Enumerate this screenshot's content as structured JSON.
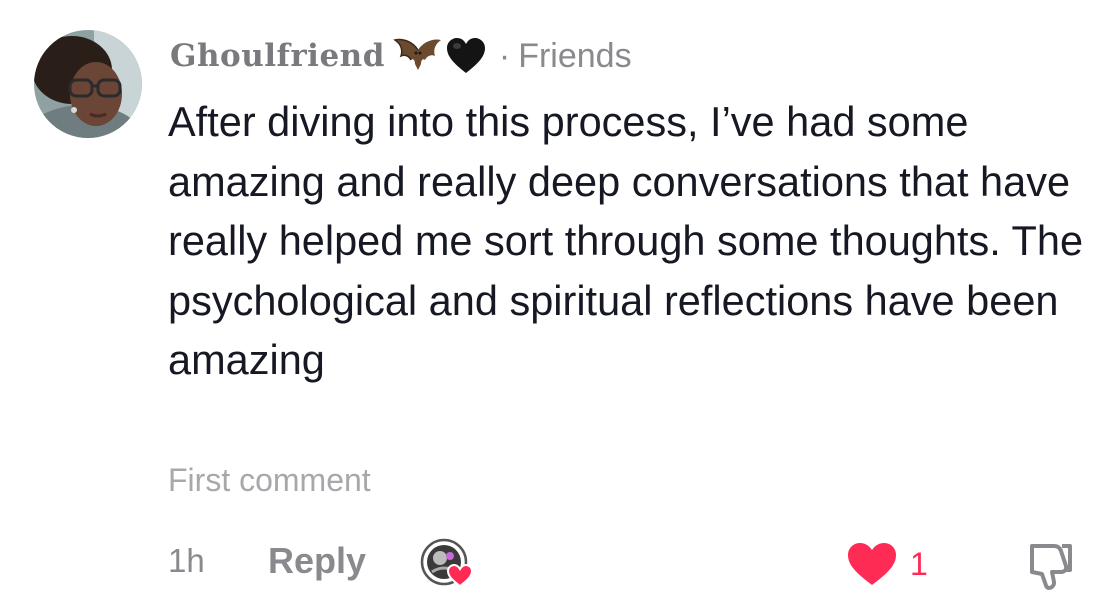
{
  "comment": {
    "username": "Ghoulfriend",
    "username_emojis": [
      "bat-icon",
      "black-heart-icon"
    ],
    "separator": "·",
    "relation": "Friends",
    "text": "After diving into this process, I’ve had some amazing and really deep conversations that have really helped me sort through some thoughts. The psychological and spiritual reflections have been amazing",
    "badge": "First comment",
    "time": "1h",
    "reply_label": "Reply",
    "like_count": "1",
    "liked": true
  },
  "colors": {
    "text_primary": "#161823",
    "text_secondary": "#8a8a8e",
    "badge": "#a8a8ac",
    "like": "#fe2c55"
  },
  "icons": {
    "creator_liked": "creator-liked-icon",
    "like": "heart-filled-icon",
    "dislike": "thumbs-down-icon"
  }
}
